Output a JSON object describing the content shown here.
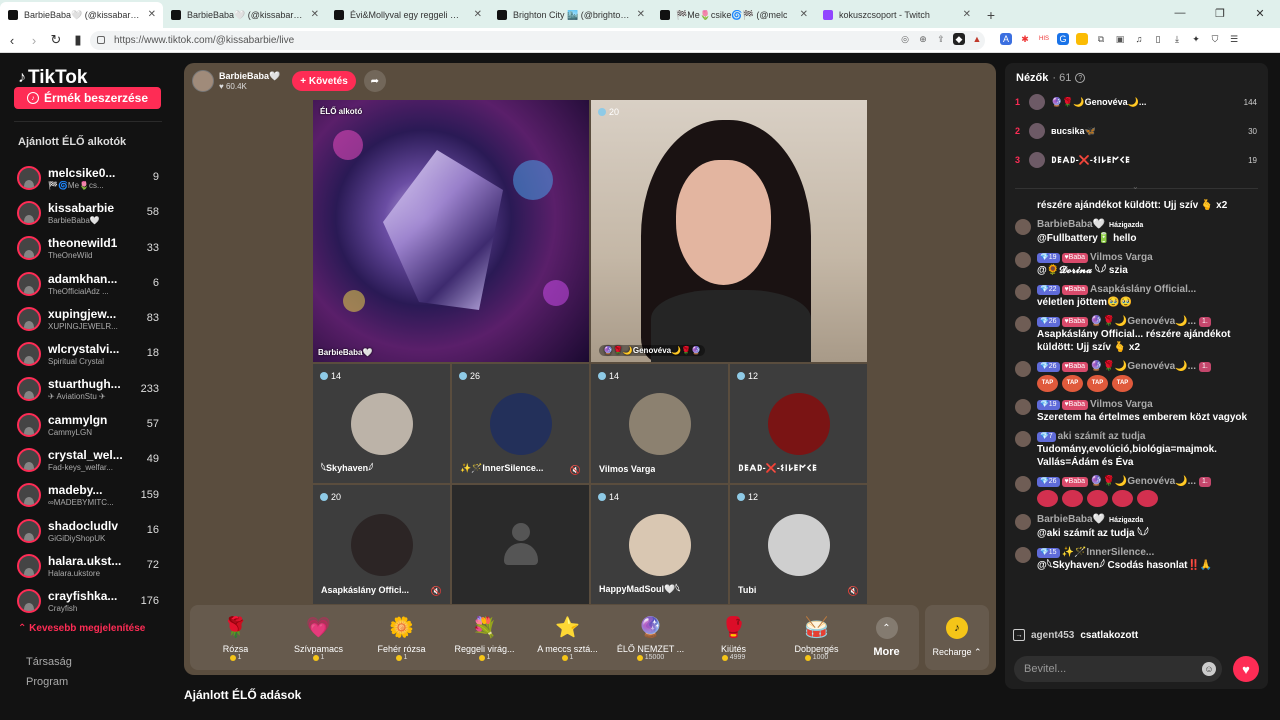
{
  "browser": {
    "tabs": [
      {
        "title": "BarbieBaba🤍 (@kissabarbie",
        "active": true,
        "icon": "tiktok-icon"
      },
      {
        "title": "BarbieBaba🤍 (@kissabarbie) ÉLŐ",
        "active": false,
        "icon": "tiktok-icon"
      },
      {
        "title": "Évi&Mollyval egy reggeli 🥰😍 (@m",
        "active": false,
        "icon": "tiktok-icon"
      },
      {
        "title": "Brighton City 🏙️ (@brighton.city) ÉLŐ",
        "active": false,
        "icon": "tiktok-icon"
      },
      {
        "title": "🏁Me🌷csike🌀🏁 (@melc",
        "active": false,
        "icon": "tiktok-icon"
      },
      {
        "title": "kokuszcsoport - Twitch",
        "active": false,
        "icon": "twitch-icon"
      }
    ],
    "url": "https://www.tiktok.com/@kissabarbie/live"
  },
  "sidebar": {
    "logo": "TikTok",
    "coins_button": "Érmék beszerzése",
    "section_title": "Ajánlott ÉLŐ alkotók",
    "creators": [
      {
        "name": "melcsike0...",
        "sub": "🏁🌀Me🌷cs...",
        "count": "9"
      },
      {
        "name": "kissabarbie",
        "sub": "BarbieBaba🤍",
        "count": "58"
      },
      {
        "name": "theonewild1",
        "sub": "TheOneWild",
        "count": "33"
      },
      {
        "name": "adamkhan...",
        "sub": "TheOfficialAdz ...",
        "count": "6"
      },
      {
        "name": "xupingjew...",
        "sub": "XUPINGJEWELR...",
        "count": "83"
      },
      {
        "name": "wlcrystalvi...",
        "sub": "Spiritual Crystal",
        "count": "18"
      },
      {
        "name": "stuarthugh...",
        "sub": "✈ AviationStu ✈",
        "count": "233"
      },
      {
        "name": "cammylgn",
        "sub": "CammyLGN",
        "count": "57"
      },
      {
        "name": "crystal_wel...",
        "sub": "Fad-keys_welfar...",
        "count": "49"
      },
      {
        "name": "madeby...",
        "sub": "∞MADEBYMITC...",
        "count": "159"
      },
      {
        "name": "shadocludlv",
        "sub": "GiGiDiyShopUK",
        "count": "16"
      },
      {
        "name": "halara.ukst...",
        "sub": "Halara.ukstore",
        "count": "72"
      },
      {
        "name": "crayfishka...",
        "sub": "Crayfish",
        "count": "176"
      }
    ],
    "show_less": "Kevesebb megjelenítése",
    "footer_links": [
      "Társaság",
      "Program"
    ]
  },
  "host": {
    "name": "BarbieBaba🤍",
    "likes": "60.4K",
    "follow_label": "+ Követés"
  },
  "stage": {
    "live_label": "ÉLŐ alkotó",
    "host_label": "BarbieBaba🤍",
    "cohost_count": "20",
    "cohost_label": "🔮🌹🌙Genovéva🌙🌹🔮",
    "guests": [
      {
        "count": "14",
        "name": "𓆩Skyhaven𓆪",
        "muted": false
      },
      {
        "count": "26",
        "name": "✨🪄InnerSilence...",
        "muted": true
      },
      {
        "count": "14",
        "name": "Vilmos Varga",
        "muted": false
      },
      {
        "count": "12",
        "name": "𐌃𐌄𐌀𐌃-❌-𐌔𐌉𐌋𐌄𐌍𐌂𐌄",
        "muted": false
      },
      {
        "count": "20",
        "name": "Asapkáslány Offici...",
        "muted": true
      },
      {
        "count": "",
        "name": "",
        "muted": false
      },
      {
        "count": "14",
        "name": "HappyMadSoul🤍𓆩",
        "muted": false
      },
      {
        "count": "12",
        "name": "Tubi",
        "muted": true
      }
    ]
  },
  "gifts": [
    {
      "name": "Rózsa",
      "price": "1",
      "icon": "🌹"
    },
    {
      "name": "Szívpamacs",
      "price": "1",
      "icon": "💗"
    },
    {
      "name": "Fehér rózsa",
      "price": "1",
      "icon": "🌼"
    },
    {
      "name": "Reggeli virág...",
      "price": "1",
      "icon": "💐"
    },
    {
      "name": "A meccs sztá...",
      "price": "1",
      "icon": "⭐"
    },
    {
      "name": "ÉLŐ NEMZET ...",
      "price": "15000",
      "icon": "🔮"
    },
    {
      "name": "Kiütés",
      "price": "4999",
      "icon": "🥊"
    },
    {
      "name": "Dobpergés",
      "price": "1000",
      "icon": "🥁"
    }
  ],
  "more_label": "More",
  "recharge_label": "Recharge ⌃",
  "recommended_title": "Ajánlott ÉLŐ adások",
  "chat": {
    "viewers_label": "Nézők",
    "viewers_count": "· 61",
    "top_viewers": [
      {
        "rank": "1",
        "name": "🔮🌹🌙Genovéva🌙...",
        "score": "144"
      },
      {
        "rank": "2",
        "name": "ʙucsika🦋",
        "score": "30"
      },
      {
        "rank": "3",
        "name": "𐌃𐌄𐌀𐌃-❌-𐌔𐌉𐌋𐌄𐌍𐌂𐌄",
        "score": "19"
      }
    ],
    "messages": [
      {
        "name": "",
        "text": "részére ajándékot küldött: Ujj szív 🫰 x2"
      },
      {
        "name": "BarbieBaba🤍",
        "host": "Házigazda",
        "text": "@Fullbattery🔋 hello"
      },
      {
        "lvl": "19",
        "fan": "Baba",
        "name": "Vilmos Varga",
        "text": "@🌻𝓓𝓸𝓻𝓲𝓷𝓪 𓆩𓆪 szia"
      },
      {
        "lvl": "22",
        "fan": "Baba",
        "name": "Asapkáslány Official...",
        "text": "véletlen jöttem🥹🥹"
      },
      {
        "lvl": "26",
        "fan": "Baba",
        "name": "🔮🌹🌙Genovéva🌙...",
        "rank": "1.",
        "text": "Asapkáslány Official... részére ajándékot küldött: Ujj szív 🫰 x2"
      },
      {
        "lvl": "26",
        "fan": "Baba",
        "name": "🔮🌹🌙Genovéva🌙...",
        "rank": "1.",
        "text": "",
        "taps": [
          "TAP",
          "TAP",
          "TAP",
          "TAP"
        ]
      },
      {
        "lvl": "19",
        "fan": "Baba",
        "name": "Vilmos Varga",
        "text": "Szeretem ha értelmes emberem közt vagyok"
      },
      {
        "lvl": "7",
        "name": "aki számít az tudja",
        "text": "Tudomány,evolúció,biológia=majmok. Vallás=Ádám és Éva"
      },
      {
        "lvl": "26",
        "fan": "Baba",
        "name": "🔮🌹🌙Genovéva🌙...",
        "rank": "1.",
        "text": "",
        "hearts": [
          "",
          "",
          "",
          "",
          ""
        ]
      },
      {
        "name": "BarbieBaba🤍",
        "host": "Házigazda",
        "text": "@aki számít az tudja 𓆩𓆪"
      },
      {
        "lvl": "15",
        "name": "✨🪄InnerSilence...",
        "text": "@𓆩Skyhaven𓆪 Csodás hasonlat‼️🙏"
      }
    ],
    "joined": {
      "name": "agent453",
      "text": "csatlakozott"
    },
    "input_placeholder": "Bevitel..."
  }
}
